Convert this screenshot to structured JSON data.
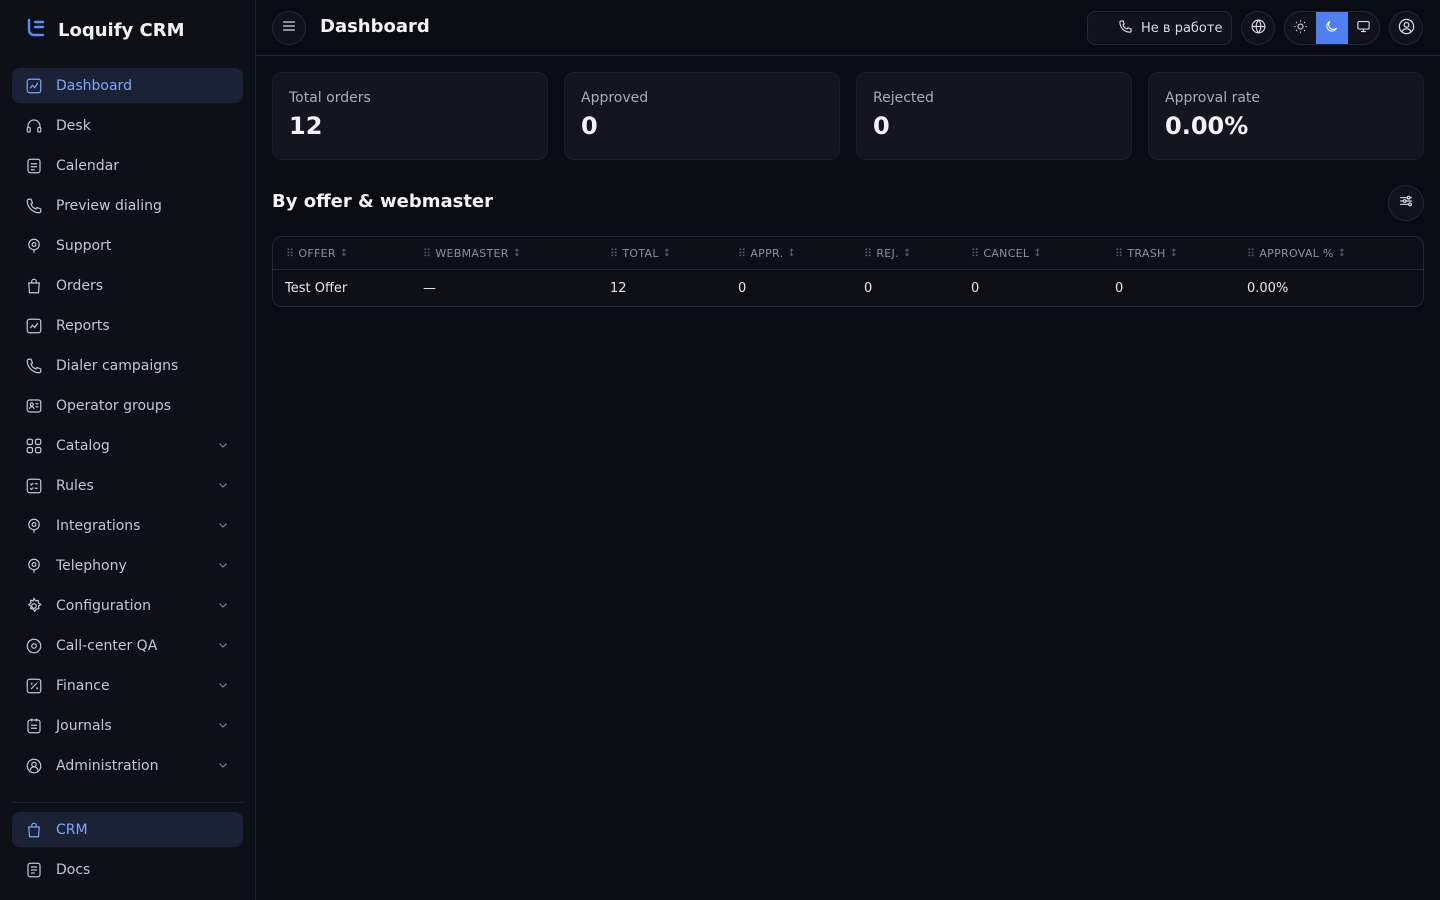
{
  "app": {
    "name": "Loquify CRM"
  },
  "sidebar": {
    "items": [
      {
        "label": "Dashboard",
        "icon": "chart-icon",
        "active": true,
        "expandable": false
      },
      {
        "label": "Desk",
        "icon": "headset-icon",
        "active": false,
        "expandable": false
      },
      {
        "label": "Calendar",
        "icon": "calendar-icon",
        "active": false,
        "expandable": false
      },
      {
        "label": "Preview dialing",
        "icon": "phone-icon",
        "active": false,
        "expandable": false
      },
      {
        "label": "Support",
        "icon": "support-icon",
        "active": false,
        "expandable": false
      },
      {
        "label": "Orders",
        "icon": "bag-icon",
        "active": false,
        "expandable": false
      },
      {
        "label": "Reports",
        "icon": "chart-icon",
        "active": false,
        "expandable": false
      },
      {
        "label": "Dialer campaigns",
        "icon": "phone-icon",
        "active": false,
        "expandable": false
      },
      {
        "label": "Operator groups",
        "icon": "group-icon",
        "active": false,
        "expandable": false
      },
      {
        "label": "Catalog",
        "icon": "grid-icon",
        "active": false,
        "expandable": true
      },
      {
        "label": "Rules",
        "icon": "rules-icon",
        "active": false,
        "expandable": true
      },
      {
        "label": "Integrations",
        "icon": "support-icon",
        "active": false,
        "expandable": true
      },
      {
        "label": "Telephony",
        "icon": "support-icon",
        "active": false,
        "expandable": true
      },
      {
        "label": "Configuration",
        "icon": "gear-icon",
        "active": false,
        "expandable": true
      },
      {
        "label": "Call-center QA",
        "icon": "eye-icon",
        "active": false,
        "expandable": true
      },
      {
        "label": "Finance",
        "icon": "finance-icon",
        "active": false,
        "expandable": true
      },
      {
        "label": "Journals",
        "icon": "journal-icon",
        "active": false,
        "expandable": true
      },
      {
        "label": "Administration",
        "icon": "admin-icon",
        "active": false,
        "expandable": true
      }
    ],
    "bottom_items": [
      {
        "label": "CRM",
        "icon": "bag-icon",
        "active": true
      },
      {
        "label": "Docs",
        "icon": "doc-icon",
        "active": false
      }
    ]
  },
  "topbar": {
    "title": "Dashboard",
    "status_label": "Не в работе",
    "theme_selected": "dark"
  },
  "stats": [
    {
      "label": "Total orders",
      "value": "12"
    },
    {
      "label": "Approved",
      "value": "0"
    },
    {
      "label": "Rejected",
      "value": "0"
    },
    {
      "label": "Approval rate",
      "value": "0.00%"
    }
  ],
  "section": {
    "title": "By offer & webmaster"
  },
  "table": {
    "headers": [
      "OFFER",
      "WEBMASTER",
      "TOTAL",
      "APPR.",
      "REJ.",
      "CANCEL",
      "TRASH",
      "APPROVAL %"
    ],
    "rows": [
      [
        "Test Offer",
        "—",
        "12",
        "0",
        "0",
        "0",
        "0",
        "0.00%"
      ]
    ]
  },
  "colors": {
    "accent": "#4f7ff0",
    "active_text": "#7ea6ff",
    "background": "#0a0c14",
    "card": "#14161f"
  }
}
